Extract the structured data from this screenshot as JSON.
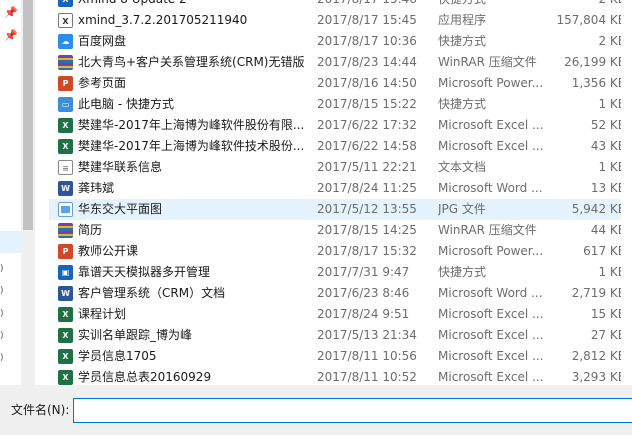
{
  "nav": {
    "pins": [
      "pin-icon",
      "pin-icon"
    ],
    "arrows": [
      ")",
      ")",
      ")",
      ")",
      ")"
    ]
  },
  "files": [
    {
      "name": "Xmind 8 Update 2",
      "date": "2017/8/17 15:46",
      "type": "快捷方式",
      "size": "2 KB",
      "icon": "shortcut-icon",
      "ic": "ic-app",
      "glyph": "X"
    },
    {
      "name": "xmind_3.7.2.201705211940",
      "date": "2017/8/17 15:45",
      "type": "应用程序",
      "size": "157,804 KB",
      "icon": "application-icon",
      "ic": "ic-exe",
      "glyph": "X"
    },
    {
      "name": "百度网盘",
      "date": "2017/8/17 10:36",
      "type": "快捷方式",
      "size": "2 KB",
      "icon": "cloud-icon",
      "ic": "ic-cloud",
      "glyph": "☁"
    },
    {
      "name": "北大青鸟+客户关系管理系统(CRM)无错版",
      "date": "2017/8/23 14:44",
      "type": "WinRAR 压缩文件",
      "size": "26,199 KB",
      "icon": "winrar-icon",
      "ic": "ic-rar",
      "glyph": ""
    },
    {
      "name": "参考页面",
      "date": "2017/8/16 14:50",
      "type": "Microsoft Power...",
      "size": "1,356 KB",
      "icon": "powerpoint-icon",
      "ic": "ic-ppt",
      "glyph": "P"
    },
    {
      "name": "此电脑 - 快捷方式",
      "date": "2017/8/15 15:22",
      "type": "快捷方式",
      "size": "1 KB",
      "icon": "computer-icon",
      "ic": "ic-pc",
      "glyph": "▭"
    },
    {
      "name": "樊建华-2017年上海博为峰软件股份有限...",
      "date": "2017/6/22 17:32",
      "type": "Microsoft Excel ...",
      "size": "52 KB",
      "icon": "excel-icon",
      "ic": "ic-excel",
      "glyph": "X"
    },
    {
      "name": "樊建华-2017年上海博为峰软件技术股份...",
      "date": "2017/6/22 14:58",
      "type": "Microsoft Excel ...",
      "size": "43 KB",
      "icon": "excel-icon",
      "ic": "ic-excel",
      "glyph": "X"
    },
    {
      "name": "樊建华联系信息",
      "date": "2017/5/11 22:21",
      "type": "文本文档",
      "size": "1 KB",
      "icon": "text-file-icon",
      "ic": "ic-txt",
      "glyph": "≡"
    },
    {
      "name": "龚玮斌",
      "date": "2017/8/24 11:25",
      "type": "Microsoft Word ...",
      "size": "13 KB",
      "icon": "word-icon",
      "ic": "ic-word",
      "glyph": "W"
    },
    {
      "name": "华东交大平面图",
      "date": "2017/5/12 13:55",
      "type": "JPG 文件",
      "size": "5,942 KB",
      "icon": "image-icon",
      "ic": "ic-jpg",
      "glyph": "",
      "selected": true
    },
    {
      "name": "简历",
      "date": "2017/8/15 14:25",
      "type": "WinRAR 压缩文件",
      "size": "44 KB",
      "icon": "winrar-icon",
      "ic": "ic-rar",
      "glyph": ""
    },
    {
      "name": "教师公开课",
      "date": "2017/8/17 15:32",
      "type": "Microsoft Power...",
      "size": "617 KB",
      "icon": "powerpoint-icon",
      "ic": "ic-ppt",
      "glyph": "P"
    },
    {
      "name": "靠谱天天模拟器多开管理",
      "date": "2017/7/31 9:47",
      "type": "快捷方式",
      "size": "1 KB",
      "icon": "emulator-icon",
      "ic": "ic-app",
      "glyph": "▣"
    },
    {
      "name": "客户管理系统（CRM）文档",
      "date": "2017/6/23 8:46",
      "type": "Microsoft Word ...",
      "size": "2,719 KB",
      "icon": "word-icon",
      "ic": "ic-word",
      "glyph": "W"
    },
    {
      "name": "课程计划",
      "date": "2017/8/24 9:51",
      "type": "Microsoft Excel ...",
      "size": "15 KB",
      "icon": "excel-icon",
      "ic": "ic-excel",
      "glyph": "X"
    },
    {
      "name": "实训名单跟踪_博为峰",
      "date": "2017/5/13 21:34",
      "type": "Microsoft Excel ...",
      "size": "27 KB",
      "icon": "excel-icon",
      "ic": "ic-excel",
      "glyph": "X"
    },
    {
      "name": "学员信息1705",
      "date": "2017/8/11 10:56",
      "type": "Microsoft Excel ...",
      "size": "2,812 KB",
      "icon": "excel-icon",
      "ic": "ic-excel",
      "glyph": "X"
    },
    {
      "name": "学员信息总表20160929",
      "date": "2017/8/11 10:52",
      "type": "Microsoft Excel ...",
      "size": "3,293 KB",
      "icon": "excel-icon",
      "ic": "ic-excel",
      "glyph": "X"
    }
  ],
  "footer": {
    "filename_label": "文件名(N):",
    "filename_value": ""
  }
}
